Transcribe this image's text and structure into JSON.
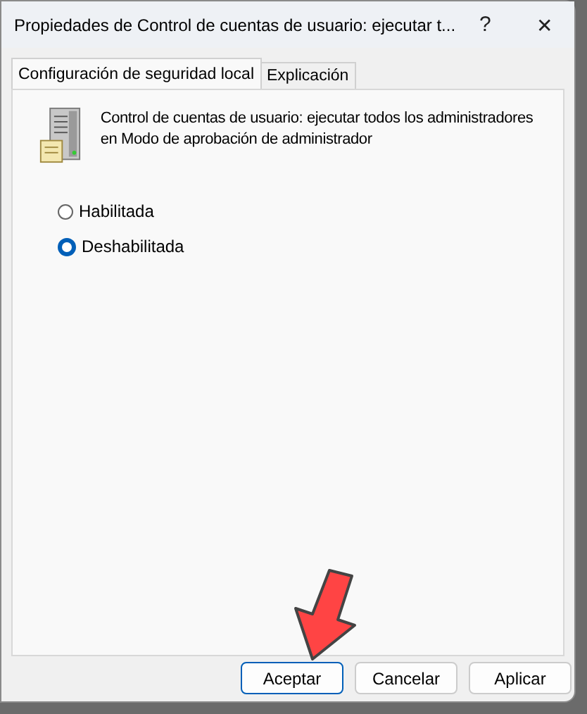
{
  "window": {
    "title": "Propiedades de Control de cuentas de usuario: ejecutar t...",
    "help": "?",
    "close": "✕"
  },
  "tabs": [
    {
      "label": "Configuración de seguridad local",
      "selected": true
    },
    {
      "label": "Explicación",
      "selected": false
    }
  ],
  "policy": {
    "description": "Control de cuentas de usuario: ejecutar todos los administradores en Modo de aprobación de administrador"
  },
  "options": [
    {
      "label": "Habilitada",
      "selected": false
    },
    {
      "label": "Deshabilitada",
      "selected": true
    }
  ],
  "buttons": [
    {
      "label": "Aceptar",
      "default": true
    },
    {
      "label": "Cancelar",
      "default": false
    },
    {
      "label": "Aplicar",
      "default": false
    }
  ]
}
